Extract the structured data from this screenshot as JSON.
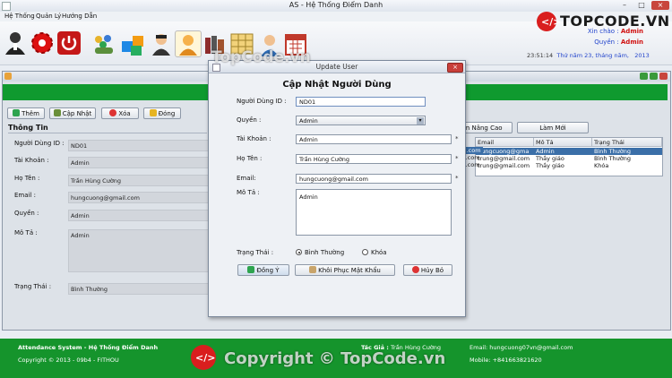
{
  "window": {
    "title": "AS - Hệ Thống Điểm Danh",
    "controls": [
      "–",
      "□",
      "×"
    ]
  },
  "menu": [
    "Hệ Thống",
    "Quản Lý",
    "Hướng Dẫn"
  ],
  "toolbar": {
    "icons": [
      "user-icon",
      "settings-gear-icon",
      "power-icon",
      "group-icon",
      "boxes-icon",
      "agent-icon",
      "user-orange-icon",
      "books-icon",
      "grid-icon",
      "person-icon",
      "calendar-icon"
    ]
  },
  "brand": {
    "logo_text": "TOPCODE.VN",
    "watermark_top": "TopCode.vn",
    "watermark_bottom": "Copyright © TopCode.vn"
  },
  "greeting": {
    "hello_prefix": "Xin chào :",
    "hello_user": "Admin",
    "role_prefix": "Quyền :",
    "role_value": "Admin"
  },
  "clock": {
    "time": "23:51:14",
    "date": "Thứ năm 23, tháng năm,",
    "year": "2013"
  },
  "actions": {
    "add": "Thêm",
    "update": "Cập Nhật",
    "delete": "Xóa",
    "close": "Đóng"
  },
  "info": {
    "section_title": "Thông Tin",
    "labels": {
      "id": "Người Dùng ID :",
      "account": "Tài Khoản :",
      "name": "Họ Tên :",
      "email": "Email :",
      "role": "Quyền :",
      "desc": "Mô Tả :",
      "status": "Trạng Thái :"
    },
    "values": {
      "id": "ND01",
      "account": "Admin",
      "name": "Trần Hùng Cường",
      "email": "hungcuong@gmail.com",
      "role": "Admin",
      "desc": "Admin",
      "status": "Bình Thường"
    }
  },
  "search": {
    "advanced": "m Nâng Cao",
    "refresh": "Làm Mới"
  },
  "table": {
    "columns": [
      "Email",
      "Mô Tả",
      "Trạng Thái"
    ],
    "rows": [
      [
        "hungcuong@gma",
        "Admin",
        "Bình Thường"
      ],
      [
        "trung@gmail.com",
        "Thầy giáo",
        "Bình Thường"
      ],
      [
        "trung@gmail.com",
        "Thầy giáo",
        "Khóa"
      ]
    ],
    "left_markers": [
      "ail.com",
      "ail.com",
      "ail.com"
    ]
  },
  "dialog": {
    "title": "Update User",
    "heading": "Cập Nhật Người Dùng",
    "labels": {
      "id": "Người Dùng ID :",
      "role": "Quyền :",
      "account": "Tài Khoản :",
      "name": "Họ Tên :",
      "email": "Email:",
      "desc": "Mô Tả :",
      "status": "Trạng Thái :"
    },
    "values": {
      "id": "ND01",
      "role": "Admin",
      "account": "Admin",
      "name": "Trần Hùng Cường",
      "email": "hungcuong@gmail.com",
      "desc": "Admin"
    },
    "status_options": {
      "normal": "Bình Thường",
      "locked": "Khóa"
    },
    "buttons": {
      "ok": "Đồng Ý",
      "reset_password": "Khôi Phục Mật Khẩu",
      "cancel": "Hủy Bỏ"
    },
    "required_mark": "*"
  },
  "footer": {
    "system": "Attendance System - Hệ Thống Điểm Danh",
    "copyright": "Copyright © 2013 - 09b4 - FITHOU",
    "author_label": "Tác Giả :",
    "author_name": "Trần Hùng Cường",
    "email": "Email: hungcuong07vn@gmail.com",
    "mobile": "Mobile: +841663821620"
  },
  "colors": {
    "green": "#0f9a2f",
    "selection": "#3b6fa8",
    "accent_red": "#d01010",
    "accent_blue": "#2244cc"
  }
}
